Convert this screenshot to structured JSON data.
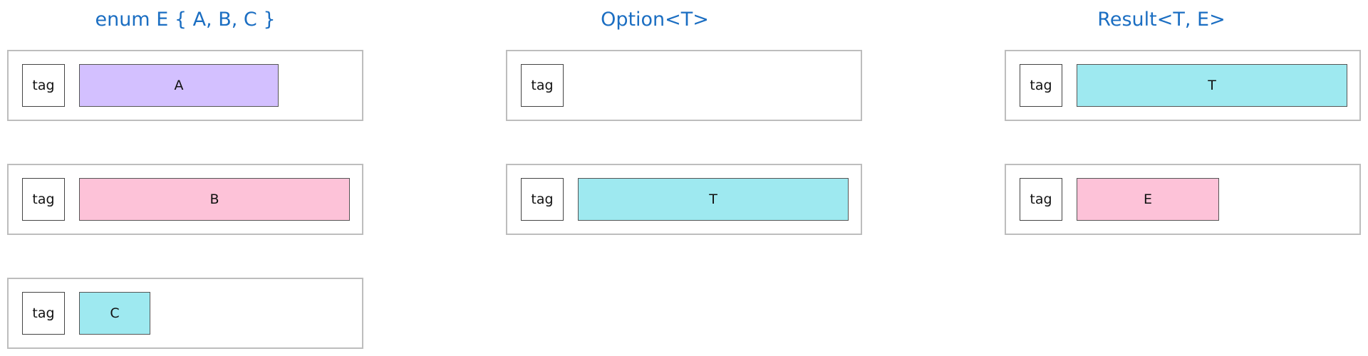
{
  "panels": [
    {
      "title": "enum E { A, B, C }",
      "rows": [
        {
          "tag": "tag",
          "payload": "A",
          "color": "#d3c0ff"
        },
        {
          "tag": "tag",
          "payload": "B",
          "color": "#fdc2d8"
        },
        {
          "tag": "tag",
          "payload": "C",
          "color": "#9ee9f0"
        }
      ]
    },
    {
      "title": "Option<T>",
      "rows": [
        {
          "tag": "tag"
        },
        {
          "tag": "tag",
          "payload": "T",
          "color": "#9ee9f0"
        }
      ]
    },
    {
      "title": "Result<T, E>",
      "rows": [
        {
          "tag": "tag",
          "payload": "T",
          "color": "#9ee9f0"
        },
        {
          "tag": "tag",
          "payload": "E",
          "color": "#fdc2d8"
        }
      ]
    }
  ]
}
